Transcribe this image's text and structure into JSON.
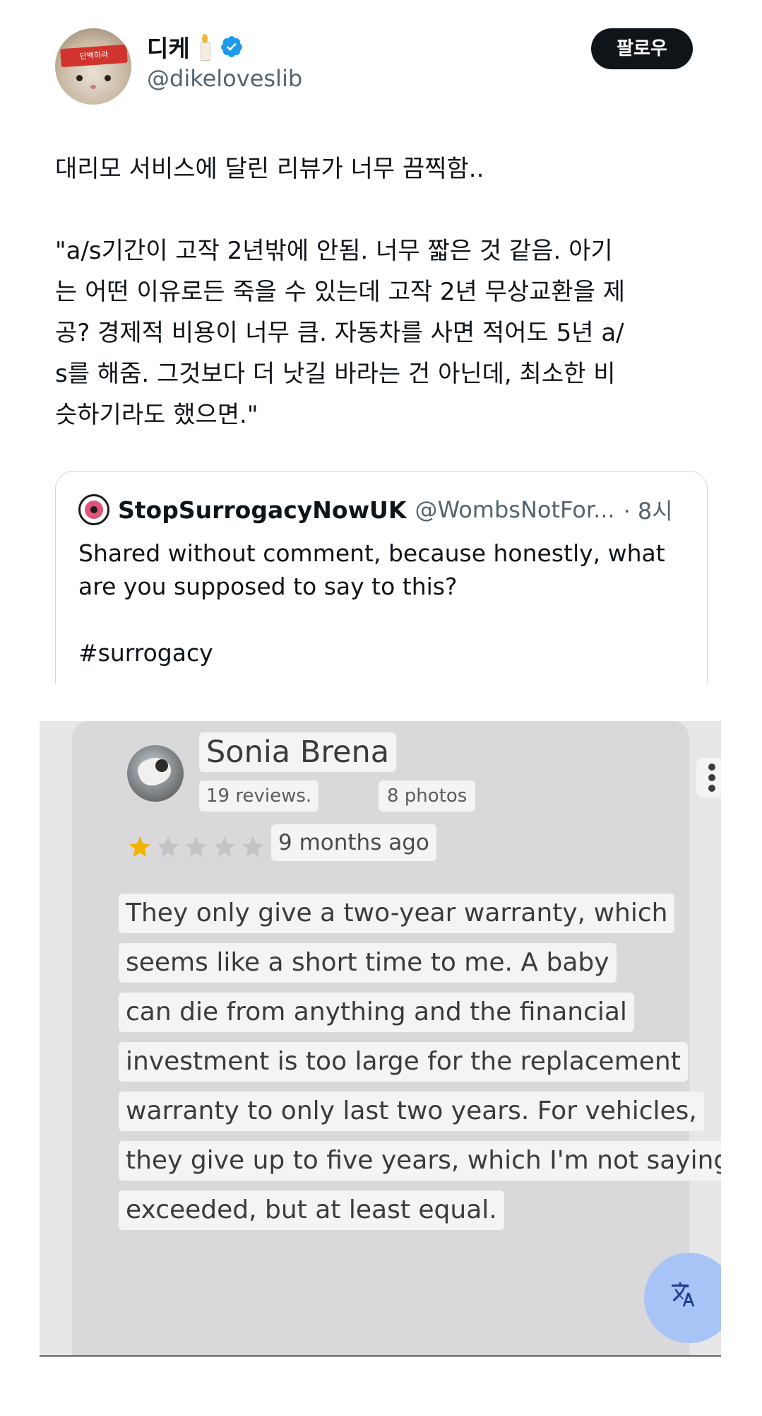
{
  "tweet": {
    "author": {
      "display_name": "디케",
      "emoji": "candle",
      "verified": true,
      "handle": "@dikeloveslib",
      "avatar_band_text": "단백하라"
    },
    "follow_label": "팔로우",
    "text": "대리모 서비스에 달린 리뷰가 너무 끔찍함..\n\n\"a/s기간이 고작 2년밖에 안됨. 너무 짧은 것 같음. 아기\n는 어떤 이유로든 죽을 수 있는데 고작 2년 무상교환을 제\n공? 경제적 비용이 너무 큼. 자동차를 사면 적어도 5년 a/\ns를 해줌. 그것보다 더 낫길 바라는 건 아닌데, 최소한 비\n슷하기라도 했으면.\"",
    "quoted": {
      "name": "StopSurrogacyNowUK",
      "handle": "@WombsNotFor...",
      "time": "· 8시",
      "text": "Shared without comment, because honestly, what\nare you supposed to say to this?\n\n#surrogacy"
    }
  },
  "review": {
    "reviewer": "Sonia Brena",
    "reviews_count": "19 reviews.",
    "photos_count": "8 photos",
    "rating": 1,
    "max_rating": 5,
    "date": "9 months ago",
    "lines": [
      "They only give a two-year warranty, which",
      "seems like a short time to me. A baby",
      "can die from anything and the financial",
      "investment is too large for the replacement",
      "warranty to only last two years. For vehicles,",
      "they give up to five years, which I'm not saying is",
      "exceeded, but at least equal."
    ],
    "colors": {
      "star_filled": "#f2b203",
      "star_empty": "#c4c4c7",
      "fab": "#a8c3f5"
    }
  }
}
